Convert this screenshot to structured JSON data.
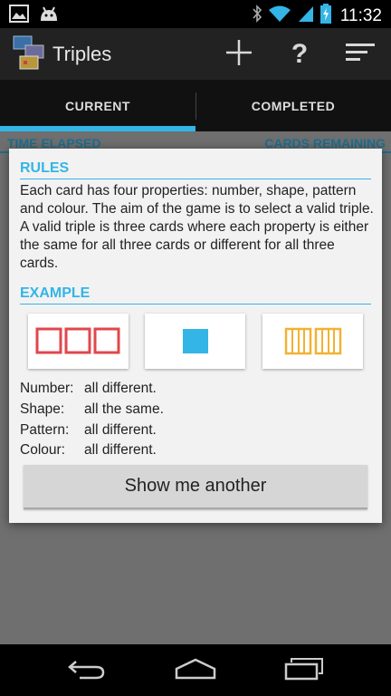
{
  "status_bar": {
    "time": "11:32",
    "icons": [
      "gallery-icon",
      "android-icon",
      "bluetooth-icon",
      "wifi-icon",
      "signal-icon",
      "battery-charging-icon"
    ]
  },
  "action_bar": {
    "title": "Triples",
    "icons": [
      "app-logo-icon",
      "add-icon",
      "help-icon",
      "overflow-menu-icon"
    ],
    "help_glyph": "?"
  },
  "tabs": [
    {
      "label": "CURRENT",
      "selected": true
    },
    {
      "label": "COMPLETED",
      "selected": false
    }
  ],
  "background": {
    "time_elapsed_label": "TIME ELAPSED",
    "cards_remaining_label": "CARDS REMAINING"
  },
  "dialog": {
    "rules_title": "RULES",
    "rules_text": "Each card has four properties: number, shape, pattern and colour. The aim of the game is to select a valid triple. A valid triple is three cards where each property is either the same for all three cards or different for all three cards.",
    "example_title": "EXAMPLE",
    "cards": [
      {
        "number": 3,
        "shape": "square",
        "pattern": "outline",
        "colour": "#e0474c"
      },
      {
        "number": 1,
        "shape": "square",
        "pattern": "solid",
        "colour": "#33b5e5"
      },
      {
        "number": 2,
        "shape": "square",
        "pattern": "striped",
        "colour": "#f2b133"
      }
    ],
    "properties": [
      {
        "key": "Number:",
        "value": "all different."
      },
      {
        "key": "Shape:",
        "value": "all the same."
      },
      {
        "key": "Pattern:",
        "value": "all different."
      },
      {
        "key": "Colour:",
        "value": "all different."
      }
    ],
    "show_another_label": "Show me another"
  },
  "nav_bar": {
    "icons": [
      "back-icon",
      "home-icon",
      "recent-apps-icon"
    ]
  },
  "colors": {
    "accent": "#33b5e5",
    "red": "#e0474c",
    "yellow": "#f2b133"
  }
}
